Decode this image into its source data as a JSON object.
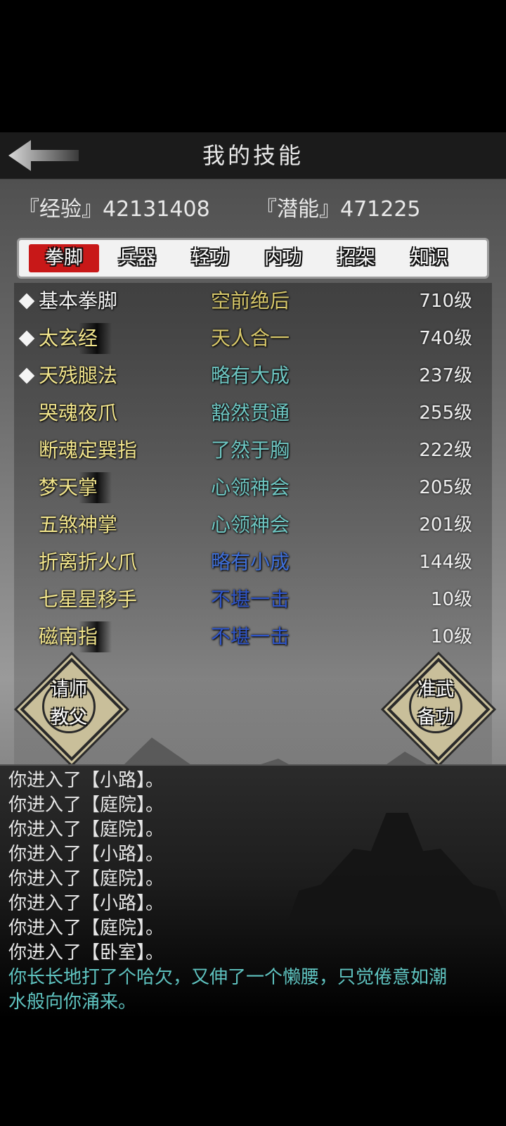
{
  "header": {
    "title": "我的技能",
    "back_icon": "arrow-left-icon"
  },
  "stats": {
    "exp_label": "『经验』42131408",
    "potential_label": "『潜能』471225"
  },
  "tabs": [
    "拳脚",
    "兵器",
    "轻功",
    "内功",
    "招架",
    "知识"
  ],
  "active_tab": "拳脚",
  "skills": [
    {
      "name": "基本拳脚",
      "grade": "空前绝后",
      "level": "710级",
      "marked": true,
      "name_color": "#f4f4f4",
      "grade_color": "#d8c86a"
    },
    {
      "name": "太玄经",
      "grade": "天人合一",
      "level": "740级",
      "marked": true,
      "name_color": "#f2e58c",
      "grade_color": "#d8c86a"
    },
    {
      "name": "天残腿法",
      "grade": "略有大成",
      "level": "237级",
      "marked": true,
      "name_color": "#f2e58c",
      "grade_color": "#6ec6c2"
    },
    {
      "name": "哭魂夜爪",
      "grade": "豁然贯通",
      "level": "255级",
      "marked": false,
      "name_color": "#f2e58c",
      "grade_color": "#6ec6c2"
    },
    {
      "name": "断魂定巽指",
      "grade": "了然于胸",
      "level": "222级",
      "marked": false,
      "name_color": "#f2e58c",
      "grade_color": "#6ec6c2"
    },
    {
      "name": "梦天掌",
      "grade": "心领神会",
      "level": "205级",
      "marked": false,
      "name_color": "#f2e58c",
      "grade_color": "#6ec6c2"
    },
    {
      "name": "五煞神掌",
      "grade": "心领神会",
      "level": "201级",
      "marked": false,
      "name_color": "#f2e58c",
      "grade_color": "#6ec6c2"
    },
    {
      "name": "折离折火爪",
      "grade": "略有小成",
      "level": "144级",
      "marked": false,
      "name_color": "#f2e58c",
      "grade_color": "#3f6fd8"
    },
    {
      "name": "七星星移手",
      "grade": "不堪一击",
      "level": "10级",
      "marked": false,
      "name_color": "#f2e58c",
      "grade_color": "#2f55c8"
    },
    {
      "name": "磁南指",
      "grade": "不堪一击",
      "level": "10级",
      "marked": false,
      "name_color": "#f2e58c",
      "grade_color": "#2f55c8"
    }
  ],
  "buttons": {
    "teacher": {
      "line1": "请师",
      "line2": "教父"
    },
    "prepare": {
      "line1": "准武",
      "line2": "备功"
    }
  },
  "log": [
    "你进入了【小路】。",
    "你进入了【庭院】。",
    "你进入了【庭院】。",
    "你进入了【小路】。",
    "你进入了【庭院】。",
    "你进入了【小路】。",
    "你进入了【庭院】。",
    "你进入了【卧室】。",
    "你长长地打了个哈欠，又伸了一个懒腰，只觉倦意如潮",
    "水般向你涌来。"
  ],
  "colors": {
    "active_tab_bg": "#c81818",
    "log_highlight": "#5fc3c0"
  }
}
